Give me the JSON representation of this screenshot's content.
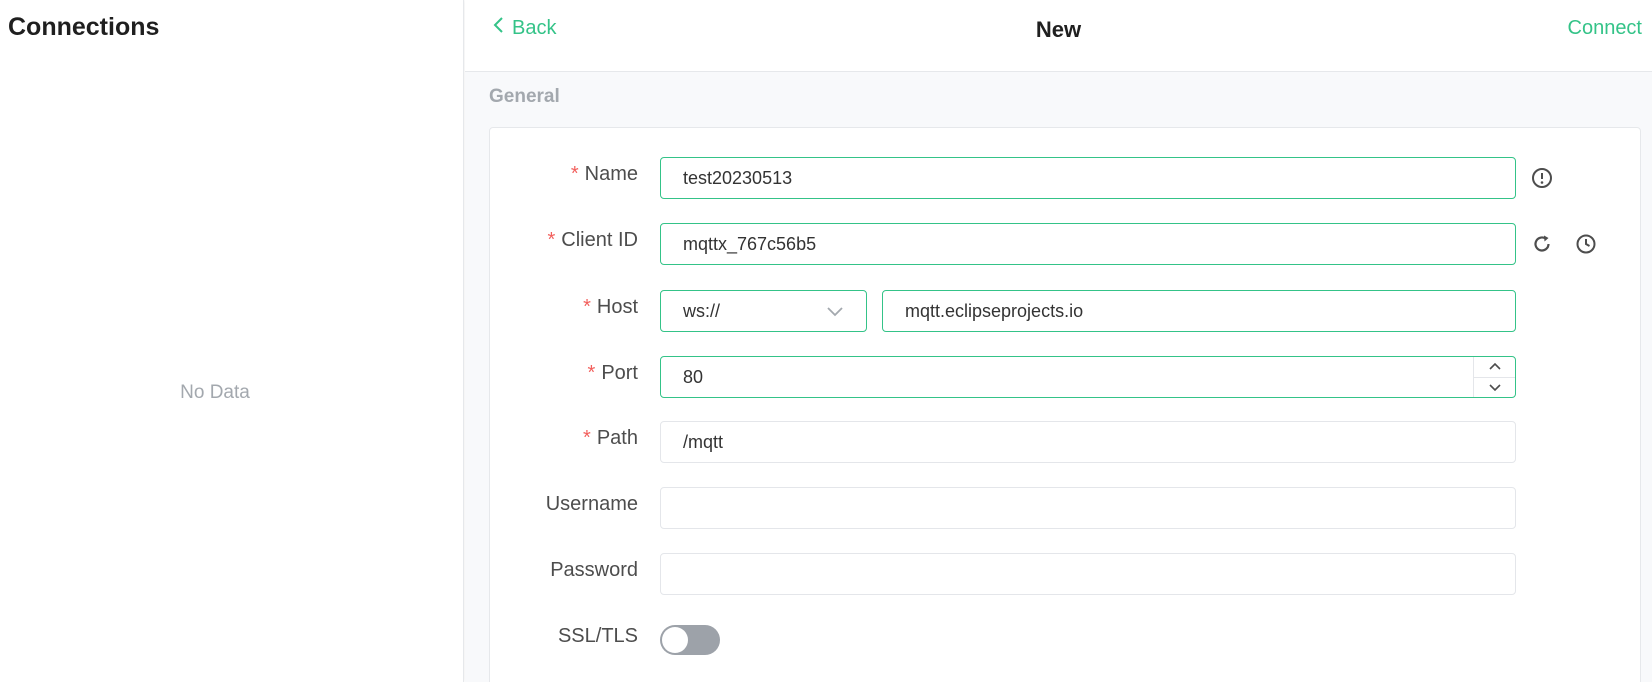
{
  "sidebar": {
    "title": "Connections",
    "empty_text": "No Data"
  },
  "header": {
    "back_label": "Back",
    "title": "New",
    "connect_label": "Connect"
  },
  "form": {
    "section_title": "General",
    "required_mark": "*",
    "name": {
      "label": "Name",
      "value": "test20230513",
      "required": true
    },
    "client_id": {
      "label": "Client ID",
      "value": "mqttx_767c56b5",
      "required": true
    },
    "host": {
      "label": "Host",
      "protocol": "ws://",
      "value": "mqtt.eclipseprojects.io",
      "required": true
    },
    "port": {
      "label": "Port",
      "value": "80",
      "required": true
    },
    "path": {
      "label": "Path",
      "value": "/mqtt",
      "required": true
    },
    "username": {
      "label": "Username",
      "value": ""
    },
    "password": {
      "label": "Password",
      "value": ""
    },
    "ssl_tls": {
      "label": "SSL/TLS",
      "enabled": false
    }
  },
  "icons": {
    "name_info": "info-circle-icon",
    "client_refresh": "refresh-icon",
    "client_history": "clock-icon",
    "protocol_dropdown": "chevron-down-icon",
    "back": "chevron-left-icon",
    "port_up": "chevron-up-icon",
    "port_down": "chevron-down-icon"
  },
  "colors": {
    "accent": "#34c388",
    "required": "#f25f5c",
    "muted": "#a3a8ae",
    "toggle_off": "#9da2a9"
  }
}
